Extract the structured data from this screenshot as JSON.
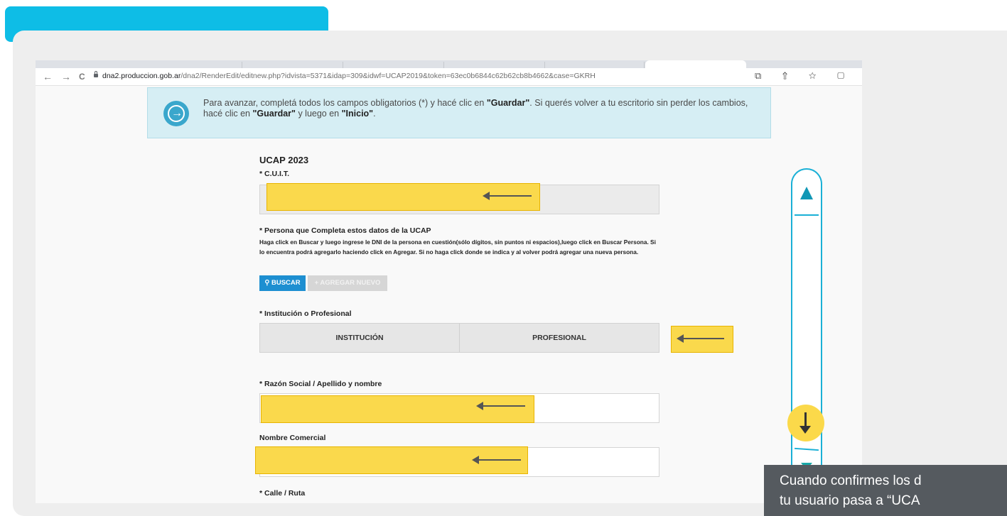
{
  "browser": {
    "url_host": "dna2.produccion.gob.ar",
    "url_path": "/dna2/RenderEdit/editnew.php?idvista=5371&idap=309&idwf=UCAP2019&token=63ec0b6844c62b62cb8b4662&case=GKRH",
    "back_glyph": "←",
    "forward_glyph": "→",
    "reload_glyph": "C",
    "toolbar_icons": "⧉ ⇪ ☆ ▢"
  },
  "notice": {
    "icon": "arrow-right-circle-icon",
    "text_1": "Para avanzar, completá todos los campos obligatorios (*) y hacé clic en ",
    "strong_1": "\"Guardar\"",
    "text_2": ". Si querés volver a tu escritorio sin perder los cambios, hacé clic en ",
    "strong_2": "\"Guardar\"",
    "text_3": " y luego en ",
    "strong_3": "\"Inicio\"",
    "text_4": "."
  },
  "form": {
    "title": "UCAP 2023",
    "cuit_label": "* C.U.I.T.",
    "persona_label": "* Persona que Completa estos datos de la UCAP",
    "persona_help": "Haga click en Buscar y luego ingrese le DNI de la persona en cuestión(sólo dígitos, sin puntos ni espacios),luego click en Buscar Persona. Si lo encuentra podrá agregarlo haciendo click en Agregar. Si no haga click donde se indica y al volver podrá agregar una nueva persona.",
    "buscar_label": "BUSCAR",
    "agregar_label": "+ AGREGAR NUEVO",
    "institucion_label": "* Institución o Profesional",
    "option_institucion": "INSTITUCIÓN",
    "option_profesional": "PROFESIONAL",
    "razon_label": "* Razón Social / Apellido y nombre",
    "nombre_comercial_label": "Nombre Comercial",
    "calle_label": "* Calle / Ruta"
  },
  "tooltip": {
    "line_1": "Cuando confirmes los d",
    "line_2": "tu usuario pasa a “UCA"
  },
  "colors": {
    "accent": "#0ebde6",
    "highlight": "#fad94c",
    "primary_button": "#1d8fd1"
  }
}
